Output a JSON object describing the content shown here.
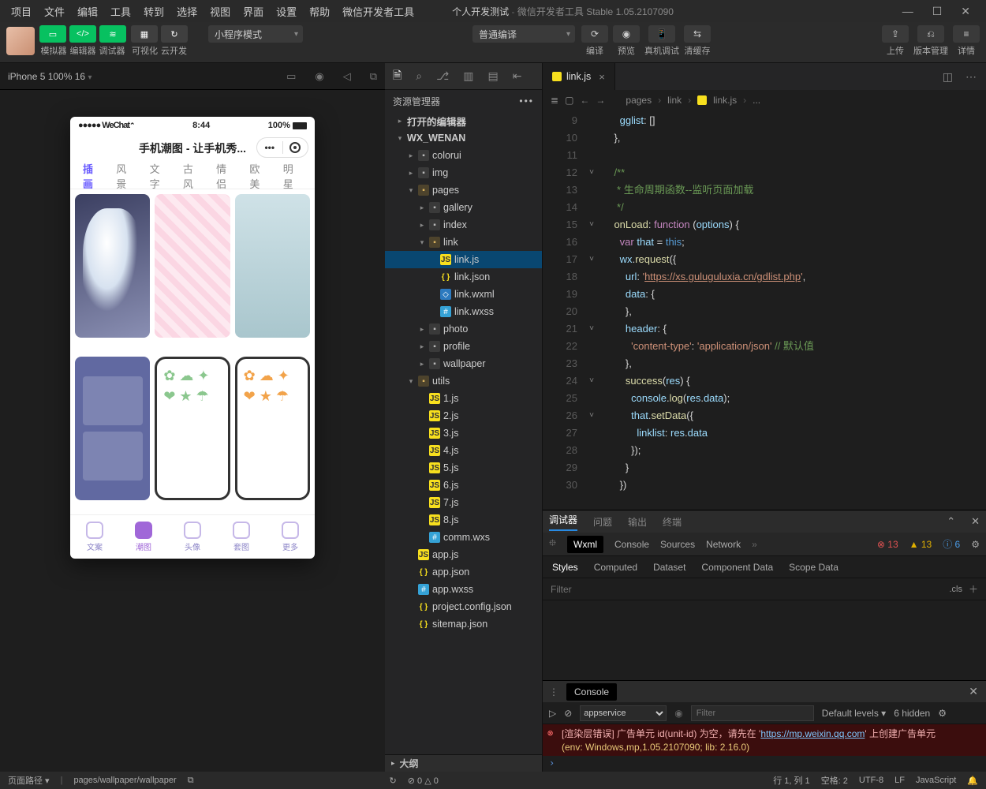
{
  "menubar": {
    "items": [
      "项目",
      "文件",
      "编辑",
      "工具",
      "转到",
      "选择",
      "视图",
      "界面",
      "设置",
      "帮助",
      "微信开发者工具"
    ],
    "title_left": "个人开发测试",
    "title_right": "微信开发者工具 Stable 1.05.2107090"
  },
  "toolbar": {
    "mode_labels": [
      "模拟器",
      "编辑器",
      "调试器",
      "可视化",
      "云开发"
    ],
    "select_left": "小程序模式",
    "select_right": "普通编译",
    "center_labels": [
      "编译",
      "预览",
      "真机调试",
      "清缓存"
    ],
    "right_labels": [
      "上传",
      "版本管理",
      "详情"
    ]
  },
  "simulator": {
    "device": "iPhone 5 100% 16",
    "status_left": "●●●●● WeChat",
    "status_time": "8:44",
    "status_batt": "100%",
    "page_title": "手机潮图 - 让手机秀...",
    "tabs": [
      "插画",
      "风景",
      "文字",
      "古风",
      "情侣",
      "欧美",
      "明星"
    ],
    "bottom": [
      "文案",
      "潮图",
      "头像",
      "套图",
      "更多"
    ]
  },
  "explorer": {
    "title": "资源管理器",
    "sections": {
      "opened": "打开的编辑器",
      "project": "WX_WENAN"
    },
    "outline": "大纲",
    "tree": [
      {
        "d": 2,
        "t": "dir",
        "n": "colorui"
      },
      {
        "d": 2,
        "t": "dir",
        "n": "img",
        "color": 1
      },
      {
        "d": 2,
        "t": "dirO",
        "n": "pages",
        "open": true
      },
      {
        "d": 3,
        "t": "dir",
        "n": "gallery"
      },
      {
        "d": 3,
        "t": "dir",
        "n": "index"
      },
      {
        "d": 3,
        "t": "dirO",
        "n": "link",
        "open": true
      },
      {
        "d": 4,
        "t": "js",
        "n": "link.js",
        "sel": true
      },
      {
        "d": 4,
        "t": "json",
        "n": "link.json"
      },
      {
        "d": 4,
        "t": "wxml",
        "n": "link.wxml"
      },
      {
        "d": 4,
        "t": "wxss",
        "n": "link.wxss"
      },
      {
        "d": 3,
        "t": "dir",
        "n": "photo"
      },
      {
        "d": 3,
        "t": "dir",
        "n": "profile"
      },
      {
        "d": 3,
        "t": "dir",
        "n": "wallpaper"
      },
      {
        "d": 2,
        "t": "dirO",
        "n": "utils",
        "open": true,
        "color": 1
      },
      {
        "d": 3,
        "t": "js",
        "n": "1.js"
      },
      {
        "d": 3,
        "t": "js",
        "n": "2.js"
      },
      {
        "d": 3,
        "t": "js",
        "n": "3.js"
      },
      {
        "d": 3,
        "t": "js",
        "n": "4.js"
      },
      {
        "d": 3,
        "t": "js",
        "n": "5.js"
      },
      {
        "d": 3,
        "t": "js",
        "n": "6.js"
      },
      {
        "d": 3,
        "t": "js",
        "n": "7.js"
      },
      {
        "d": 3,
        "t": "js",
        "n": "8.js"
      },
      {
        "d": 3,
        "t": "wxss",
        "n": "comm.wxs"
      },
      {
        "d": 2,
        "t": "js",
        "n": "app.js"
      },
      {
        "d": 2,
        "t": "json",
        "n": "app.json"
      },
      {
        "d": 2,
        "t": "wxss",
        "n": "app.wxss"
      },
      {
        "d": 2,
        "t": "json",
        "n": "project.config.json"
      },
      {
        "d": 2,
        "t": "json",
        "n": "sitemap.json"
      }
    ]
  },
  "editor_tab": "link.js",
  "breadcrumb": [
    "pages",
    "link",
    "link.js",
    "..."
  ],
  "code_url": "https://xs.guluguluxia.cn/gdlist.php",
  "code_cmt1": "生命周期函数--监听页面加载",
  "code_cmt2": "默认值",
  "debugger": {
    "top_tabs": [
      "调试器",
      "问题",
      "输出",
      "终端"
    ],
    "tools": [
      "Wxml",
      "Console",
      "Sources",
      "Network"
    ],
    "counts": {
      "err": "13",
      "warn": "13",
      "info": "6"
    },
    "style_tabs": [
      "Styles",
      "Computed",
      "Dataset",
      "Component Data",
      "Scope Data"
    ],
    "filter_ph": "Filter",
    "cls": ".cls",
    "console_label": "Console",
    "ctx": "appservice",
    "levels": "Default levels",
    "hidden": "6 hidden",
    "err_pre": "[渲染层错误] 广告单元 id(unit-id) 为空，请先在 '",
    "err_link": "https://mp.weixin.qq.com",
    "err_post": "' 上创建广告单元",
    "err_env": "(env: Windows,mp,1.05.2107090; lib: 2.16.0)"
  },
  "status": {
    "left_label": "页面路径",
    "path": "pages/wallpaper/wallpaper",
    "diag": "⊘ 0 △ 0",
    "right": [
      "行 1, 列 1",
      "空格: 2",
      "UTF-8",
      "LF",
      "JavaScript"
    ]
  }
}
